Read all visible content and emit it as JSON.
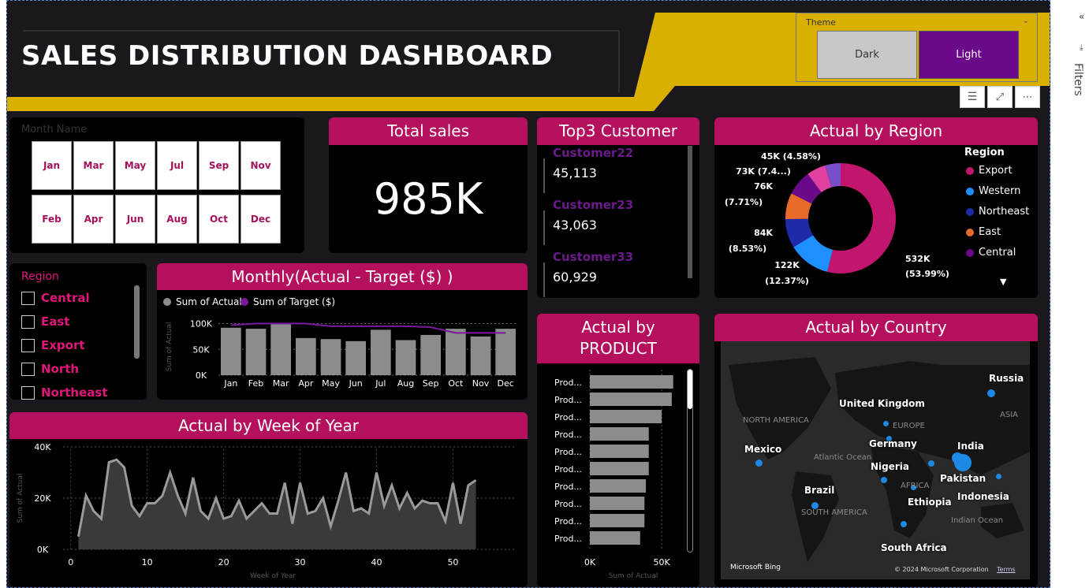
{
  "header": {
    "title": "SALES DISTRIBUTION DASHBOARD"
  },
  "theme": {
    "label": "Theme",
    "options": [
      "Dark",
      "Light"
    ],
    "selected": "Light"
  },
  "colors": {
    "accent": "#b5105e",
    "banner": "#d9b000",
    "purple": "#6a0a8a",
    "bar": "#8c8c8c"
  },
  "month_slicer": {
    "label": "Month Name",
    "months": [
      "Jan",
      "Mar",
      "May",
      "Jul",
      "Sep",
      "Nov",
      "Feb",
      "Apr",
      "Jun",
      "Aug",
      "Oct",
      "Dec"
    ]
  },
  "total_sales": {
    "title": "Total sales",
    "value": "985K"
  },
  "top3": {
    "title": "Top3 Customer",
    "customers": [
      {
        "name": "Customer22",
        "value": "45,113"
      },
      {
        "name": "Customer23",
        "value": "43,063"
      },
      {
        "name": "Customer33",
        "value": "60,929"
      }
    ]
  },
  "region_slicer": {
    "label": "Region",
    "items": [
      "Central",
      "East",
      "Export",
      "North",
      "Northeast"
    ]
  },
  "chart_data": [
    {
      "type": "bar",
      "title": "Monthly(Actual - Target ($) )",
      "legend": [
        "Sum of Actual",
        "Sum of Target ($)"
      ],
      "ylabel": "Sum of Actual",
      "categories": [
        "Jan",
        "Feb",
        "Mar",
        "Apr",
        "May",
        "Jun",
        "Jul",
        "Aug",
        "Sep",
        "Oct",
        "Nov",
        "Dec"
      ],
      "series": [
        {
          "name": "Sum of Actual",
          "values": [
            92000,
            90000,
            100000,
            72000,
            70000,
            66000,
            88000,
            68000,
            78000,
            90000,
            75000,
            90000
          ]
        },
        {
          "name": "Sum of Target ($)",
          "values": [
            97000,
            100000,
            100000,
            100000,
            95000,
            95000,
            95000,
            95000,
            93000,
            82000,
            82000,
            82000
          ]
        }
      ],
      "yticks": [
        "0K",
        "50K",
        "100K"
      ],
      "ylim": [
        0,
        110000
      ]
    },
    {
      "type": "area",
      "title": "Actual by Week of Year",
      "xlabel": "Week of Year",
      "ylabel": "Sum of Actual",
      "x": [
        1,
        2,
        3,
        4,
        5,
        6,
        7,
        8,
        9,
        10,
        11,
        12,
        13,
        14,
        15,
        16,
        17,
        18,
        19,
        20,
        21,
        22,
        23,
        24,
        25,
        26,
        27,
        28,
        29,
        30,
        31,
        32,
        33,
        34,
        35,
        36,
        37,
        38,
        39,
        40,
        41,
        42,
        43,
        44,
        45,
        46,
        47,
        48,
        49,
        50,
        51,
        52,
        53
      ],
      "values": [
        5000,
        21000,
        15000,
        12000,
        34000,
        35000,
        32000,
        17000,
        13000,
        18000,
        18000,
        21000,
        30000,
        21000,
        14000,
        28000,
        15000,
        12000,
        20000,
        12000,
        13000,
        19000,
        12000,
        15000,
        18000,
        14000,
        14000,
        26000,
        10000,
        26000,
        14000,
        15000,
        20000,
        9000,
        19000,
        30000,
        15000,
        16000,
        14000,
        30000,
        17000,
        25000,
        16000,
        22000,
        16000,
        19000,
        18000,
        18000,
        11000,
        26000,
        10000,
        25000,
        27000
      ],
      "xticks": [
        "0",
        "10",
        "20",
        "30",
        "40",
        "50"
      ],
      "yticks": [
        "0K",
        "20K",
        "40K"
      ],
      "ylim": [
        0,
        40000
      ]
    },
    {
      "type": "pie",
      "title": "Actual by Region",
      "legend_title": "Region",
      "legend": [
        "Export",
        "Western",
        "Northeast",
        "East",
        "Central"
      ],
      "series": [
        {
          "name": "Export",
          "value": 532,
          "pct": 53.99
        },
        {
          "name": "Western",
          "value": 122,
          "pct": 12.37
        },
        {
          "name": "Northeast",
          "value": 84,
          "pct": 8.53
        },
        {
          "name": "East",
          "value": 76,
          "pct": 7.71
        },
        {
          "name": "Central",
          "value": 73,
          "pct": 7.4
        },
        {
          "name": "",
          "value": 55,
          "pct": 5.56
        },
        {
          "name": "",
          "value": 45,
          "pct": 4.58
        }
      ],
      "labels": [
        "532K",
        "(53.99%)",
        "122K",
        "(12.37%)",
        "84K",
        "(8.53%)",
        "76K",
        "(7.71%)",
        "73K (7.4...)",
        "45K (4.58%)"
      ]
    },
    {
      "type": "bar",
      "title": "Actual by PRODUCT",
      "xlabel": "Sum of Actual",
      "categories": [
        "Prod...",
        "Prod...",
        "Prod...",
        "Prod...",
        "Prod...",
        "Prod...",
        "Prod...",
        "Prod...",
        "Prod...",
        "Prod..."
      ],
      "values": [
        58000,
        57000,
        50000,
        41000,
        41000,
        41000,
        39000,
        38000,
        38000,
        35000
      ],
      "xticks": [
        "0K",
        "50K"
      ],
      "xlim": [
        0,
        62000
      ]
    }
  ],
  "country": {
    "title": "Actual by Country",
    "countries": [
      "Russia",
      "United Kingdom",
      "Germany",
      "Mexico",
      "Nigeria",
      "India",
      "Pakistan",
      "Brazil",
      "Ethiopia",
      "Indonesia",
      "South Africa"
    ],
    "regions": [
      "NORTH AMERICA",
      "EUROPE",
      "ASIA",
      "Atlantic Ocean",
      "AFRICA",
      "SOUTH AMERICA",
      "Indian Ocean"
    ],
    "bing": "Microsoft Bing",
    "copyright": "© 2024 Microsoft Corporation",
    "terms": "Terms"
  },
  "filters": {
    "label": "Filters"
  }
}
